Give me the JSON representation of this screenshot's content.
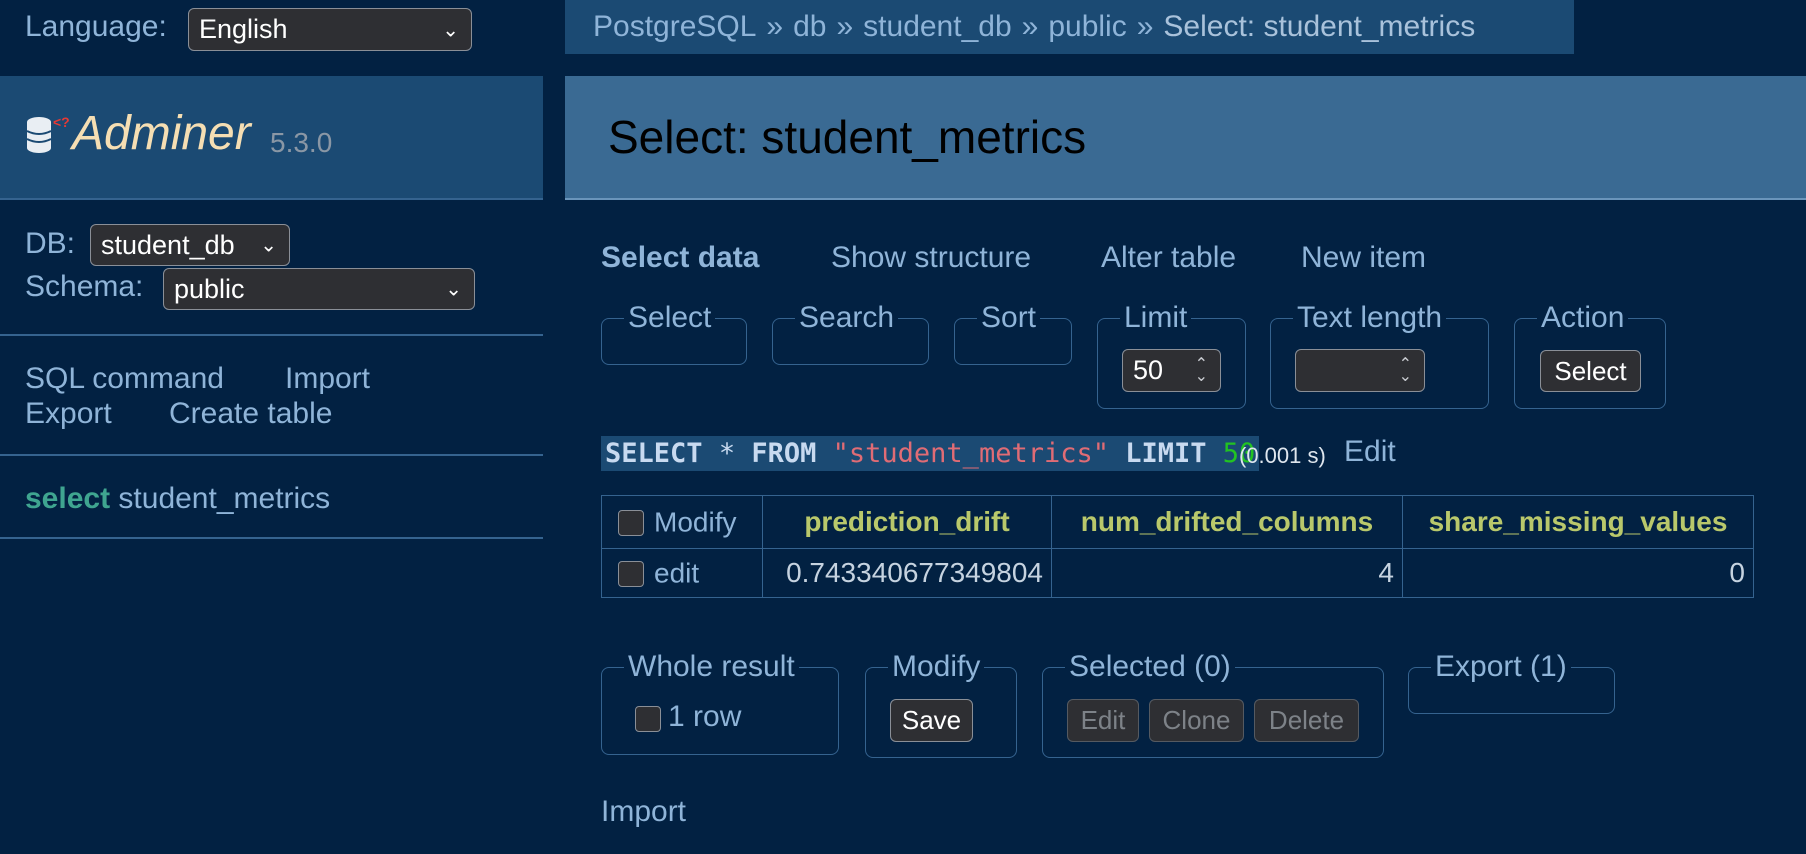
{
  "language": {
    "label": "Language:",
    "value": "English"
  },
  "breadcrumb": {
    "items": [
      "PostgreSQL",
      "db",
      "student_db",
      "public"
    ],
    "current": "Select: student_metrics"
  },
  "app": {
    "name": "Adminer",
    "version": "5.3.0"
  },
  "db": {
    "label": "DB:",
    "value": "student_db"
  },
  "schema": {
    "label": "Schema:",
    "value": "public"
  },
  "side_links": {
    "sql": "SQL command",
    "import": "Import",
    "export": "Export",
    "create": "Create table"
  },
  "tables": [
    {
      "action": "select",
      "name": "student_metrics"
    }
  ],
  "page_title": "Select: student_metrics",
  "tabs": {
    "select_data": "Select data",
    "show_structure": "Show structure",
    "alter_table": "Alter table",
    "new_item": "New item"
  },
  "form": {
    "select": "Select",
    "search": "Search",
    "sort": "Sort",
    "limit": {
      "label": "Limit",
      "value": "50"
    },
    "text_length": {
      "label": "Text length",
      "value": ""
    },
    "action": {
      "label": "Action",
      "button": "Select"
    }
  },
  "query": {
    "kw1": "SELECT",
    "star": "*",
    "kw2": "FROM",
    "table": "\"student_metrics\"",
    "kw3": "LIMIT",
    "limit": "50",
    "time": "(0.001 s)",
    "edit": "Edit"
  },
  "results": {
    "modify_header": "Modify",
    "columns": [
      "prediction_drift",
      "num_drifted_columns",
      "share_missing_values"
    ],
    "rows": [
      {
        "action": "edit",
        "values": [
          "0.743340677349804",
          "4",
          "0"
        ]
      }
    ]
  },
  "bottom": {
    "whole_result": {
      "legend": "Whole result",
      "label": "1 row"
    },
    "modify": {
      "legend": "Modify",
      "save": "Save"
    },
    "selected": {
      "legend": "Selected (0)",
      "edit": "Edit",
      "clone": "Clone",
      "delete": "Delete"
    },
    "export": {
      "legend": "Export (1)"
    }
  },
  "import_link": "Import",
  "colors": {
    "background": "#022142",
    "panel": "#1b4a73",
    "header": "#3a6a93",
    "link": "#8fb4d8",
    "column_header": "#b9c86b",
    "string": "#e06c75",
    "number": "#22c322"
  }
}
